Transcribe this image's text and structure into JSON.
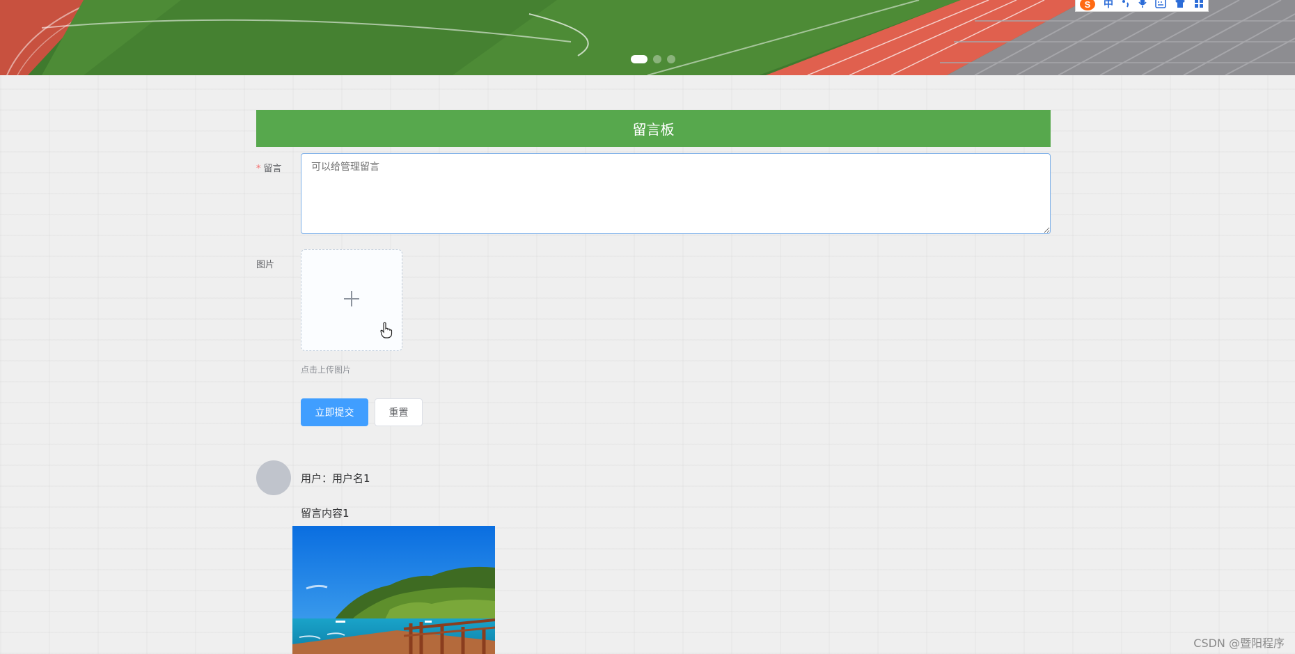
{
  "banner": {
    "carousel_dots": 3,
    "active_dot": 1
  },
  "ime_toolbar": {
    "logo": "S",
    "mode_label": "中",
    "items": [
      "punctuation-icon",
      "microphone-icon",
      "keyboard-icon",
      "skin-icon",
      "toolbox-icon"
    ]
  },
  "board": {
    "title": "留言板",
    "message_label": "留言",
    "message_placeholder": "可以给管理留言",
    "message_value": "",
    "image_label": "图片",
    "upload_tip": "点击上传图片",
    "submit_label": "立即提交",
    "reset_label": "重置"
  },
  "comment": {
    "user_text": "用户：用户名1",
    "content": "留言内容1"
  },
  "watermark": "CSDN @暨阳程序",
  "colors": {
    "header_green": "#57a84d",
    "primary_blue": "#409eff",
    "required_red": "#f56c6c",
    "avatar_gray": "#c0c4cc"
  }
}
